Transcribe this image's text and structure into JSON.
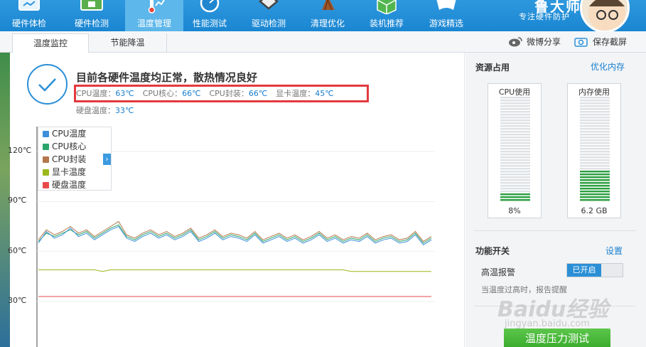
{
  "nav": {
    "items": [
      {
        "label": "硬件体检",
        "icon": "monitor-icon",
        "active": false
      },
      {
        "label": "硬件检测",
        "icon": "board-icon",
        "active": false
      },
      {
        "label": "温度管理",
        "icon": "thermometer-icon",
        "active": true
      },
      {
        "label": "性能测试",
        "icon": "speedometer-icon",
        "active": false
      },
      {
        "label": "驱动检测",
        "icon": "driver-icon",
        "active": false
      },
      {
        "label": "清理优化",
        "icon": "broom-icon",
        "active": false
      },
      {
        "label": "装机推荐",
        "icon": "cube-icon",
        "active": false
      },
      {
        "label": "游戏精选",
        "icon": "gamepad-icon",
        "active": false
      }
    ],
    "brand_title": "鲁大师",
    "brand_slogan": "专注硬件防护"
  },
  "subtabs": [
    {
      "label": "温度监控",
      "active": true
    },
    {
      "label": "节能降温",
      "active": false
    }
  ],
  "tools": {
    "weibo_share": "微博分享",
    "save_screenshot": "保存截屏"
  },
  "status": {
    "title": "目前各硬件温度均正常，散热情况良好",
    "cpu_temp_label": "CPU温度：",
    "cpu_temp": "63℃",
    "cpu_core_label": "CPU核心：",
    "cpu_core": "66℃",
    "cpu_package_label": "CPU封装：",
    "cpu_package": "66℃",
    "gpu_temp_label": "显卡温度：",
    "gpu_temp": "45℃",
    "disk_temp_label": "硬盘温度：",
    "disk_temp": "33℃"
  },
  "chart_data": {
    "type": "line",
    "y_ticks": [
      "120℃",
      "90℃",
      "60℃",
      "30℃"
    ],
    "ylim": [
      30,
      120
    ],
    "legend": [
      "CPU温度",
      "CPU核心",
      "CPU封装",
      "显卡温度",
      "硬盘温度"
    ],
    "series": [
      {
        "name": "CPU温度",
        "color": "#3d8fdb",
        "values": [
          65,
          72,
          68,
          70,
          74,
          69,
          71,
          67,
          70,
          73,
          75,
          68,
          66,
          69,
          71,
          68,
          70,
          67,
          69,
          72,
          66,
          68,
          71,
          67,
          69,
          68,
          66,
          70,
          65,
          67,
          69,
          66,
          68,
          65,
          67,
          70,
          66,
          68,
          65,
          67,
          66,
          69,
          65,
          67,
          68,
          65,
          66,
          70,
          64,
          67
        ]
      },
      {
        "name": "CPU核心",
        "color": "#2aa56b",
        "values": [
          66,
          71,
          69,
          71,
          73,
          70,
          72,
          68,
          71,
          74,
          76,
          69,
          67,
          70,
          72,
          69,
          71,
          68,
          70,
          73,
          67,
          69,
          72,
          68,
          70,
          69,
          67,
          71,
          66,
          68,
          70,
          67,
          69,
          66,
          68,
          71,
          67,
          69,
          66,
          68,
          67,
          70,
          66,
          68,
          69,
          66,
          67,
          71,
          65,
          68
        ]
      },
      {
        "name": "CPU封装",
        "color": "#b5774c",
        "values": [
          67,
          73,
          70,
          72,
          75,
          71,
          73,
          69,
          72,
          75,
          78,
          70,
          68,
          71,
          73,
          70,
          72,
          69,
          71,
          74,
          68,
          70,
          73,
          69,
          71,
          70,
          68,
          72,
          67,
          69,
          71,
          68,
          70,
          67,
          69,
          72,
          68,
          70,
          67,
          69,
          68,
          71,
          67,
          69,
          70,
          67,
          68,
          72,
          66,
          69
        ]
      },
      {
        "name": "显卡温度",
        "color": "#9ab81a",
        "values": [
          49,
          49,
          49,
          49,
          49,
          49,
          49,
          49,
          48,
          49,
          49,
          49,
          49,
          49,
          49,
          49,
          49,
          49,
          49,
          49,
          49,
          49,
          49,
          49,
          49,
          49,
          49,
          49,
          49,
          49,
          49,
          49,
          49,
          49,
          49,
          49,
          49,
          49,
          49,
          48,
          48,
          48,
          48,
          48,
          48,
          48,
          48,
          48,
          48,
          48
        ]
      },
      {
        "name": "硬盘温度",
        "color": "#e84a4a",
        "values": [
          33,
          33,
          33,
          33,
          33,
          33,
          33,
          33,
          33,
          33,
          33,
          33,
          33,
          33,
          33,
          33,
          33,
          33,
          33,
          33,
          33,
          33,
          33,
          33,
          33,
          33,
          33,
          33,
          33,
          33,
          33,
          33,
          33,
          33,
          33,
          33,
          33,
          33,
          33,
          33,
          33,
          33,
          33,
          33,
          33,
          33,
          33,
          33,
          33,
          33
        ]
      }
    ]
  },
  "resources": {
    "title": "资源占用",
    "optimize_link": "优化内存",
    "cpu_label": "CPU使用",
    "cpu_value": "8%",
    "cpu_fraction": 0.08,
    "mem_label": "内存使用",
    "mem_value": "6.2 GB",
    "mem_fraction": 0.3
  },
  "switches": {
    "title": "功能开关",
    "settings_link": "设置",
    "alarm_label": "高温报警",
    "alarm_state": "已开启",
    "alarm_desc": "当温度过高时，报告提醒"
  },
  "stress_test_button": "温度压力测试",
  "watermark": {
    "logo": "Baidu经验",
    "url": "jingyan.baidu.com"
  }
}
